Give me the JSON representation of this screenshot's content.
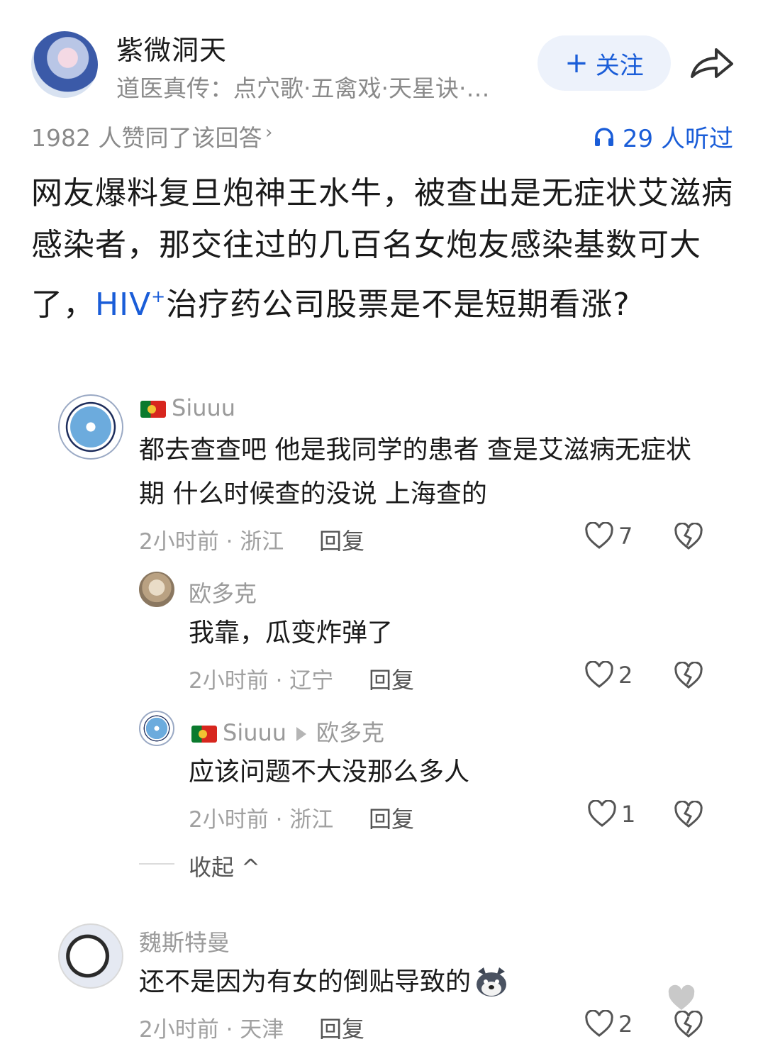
{
  "header": {
    "author_name": "紫微洞天",
    "author_sub": "道医真传：点穴歌·五禽戏·天星诀·…",
    "follow_label": "关注",
    "follow_plus": "+",
    "agree_text": "1982 人赞同了该回答",
    "agree_arrow": "›",
    "listen_text": "29 人听过"
  },
  "answer": {
    "text_before": "网友爆料复旦炮神王水牛，被查出是无症状艾滋病感染者，那交往过的几百名女炮友感染基数可大了，",
    "link_text": "HIV",
    "link_sup": "+",
    "text_after": "治疗药公司股票是不是短期看涨?"
  },
  "comments": [
    {
      "user": "Siuuu",
      "text": "都去查查吧 他是我同学的患者 查是艾滋病无症状期 什么时候查的没说 上海查的",
      "meta": "2小时前 · 浙江",
      "reply": "回复",
      "likes": "7"
    },
    {
      "user": "欧多克",
      "text": "我靠，瓜变炸弹了",
      "meta": "2小时前 · 辽宁",
      "reply": "回复",
      "likes": "2"
    },
    {
      "user": "Siuuu",
      "reply_to": "欧多克",
      "text": "应该问题不大没那么多人",
      "meta": "2小时前 · 浙江",
      "reply": "回复",
      "likes": "1"
    },
    {
      "user": "魏斯特曼",
      "text": "还不是因为有女的倒贴导致的",
      "meta": "2小时前 · 天津",
      "reply": "回复",
      "likes": "2"
    }
  ],
  "collapse_label": "收起 ^",
  "colors": {
    "accent": "#1a5dd8",
    "muted": "#8a8a8a",
    "follow_bg": "#edf2fb"
  }
}
